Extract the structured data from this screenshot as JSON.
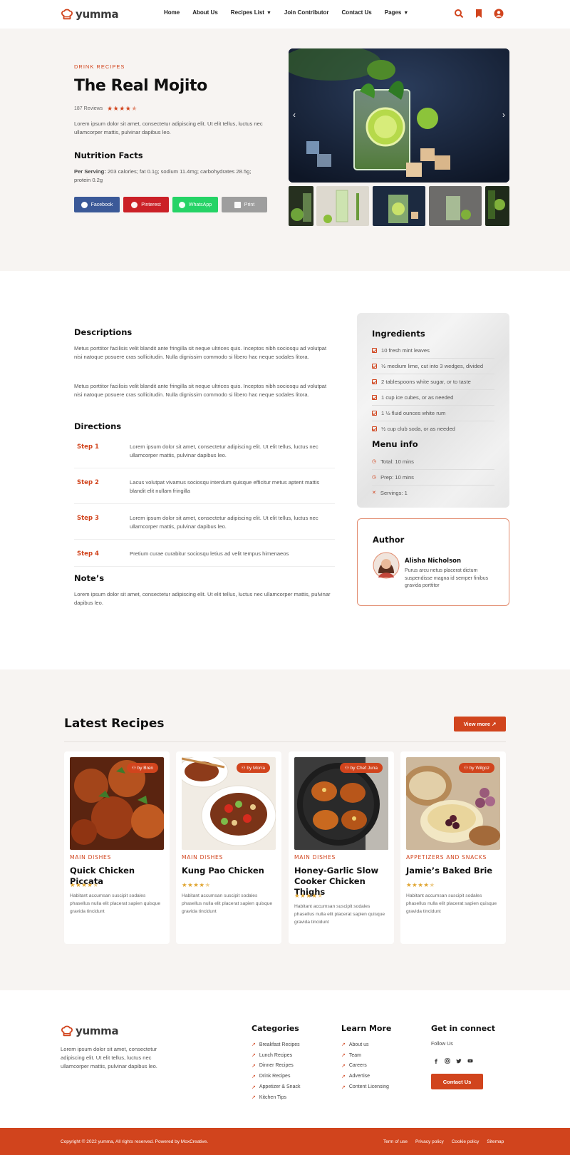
{
  "header": {
    "brand": "yumma",
    "nav": [
      "Home",
      "About Us",
      "Recipes List",
      "Join Contributor",
      "Contact Us",
      "Pages"
    ],
    "colors": {
      "accent": "#d1441d"
    }
  },
  "hero": {
    "kicker": "DRINK RECIPES",
    "title": "The Real Mojito",
    "reviews": "187 Reviews",
    "rating": 4.5,
    "intro": "Lorem ipsum dolor sit amet, consectetur adipiscing elit. Ut elit tellus, luctus nec ullamcorper mattis, pulvinar dapibus leo.",
    "nutrition_title": "Nutrition Facts",
    "per_serving_label": "Per Serving:",
    "per_serving_value": " 203 calories; fat 0.1g; sodium 11.4mg; carbohydrates 28.5g; protein 0.2g",
    "share": [
      {
        "label": "Facebook",
        "color": "#3b5998"
      },
      {
        "label": "Pinterest",
        "color": "#cb2027"
      },
      {
        "label": "WhatsApp",
        "color": "#25d366"
      },
      {
        "label": "Print",
        "color": "#9e9e9e"
      }
    ]
  },
  "content": {
    "desc_title": "Descriptions",
    "desc1": "Metus porttitor facilisis velit blandit ante fringilla sit neque ultrices quis. Inceptos nibh sociosqu ad volutpat nisi natoque posuere cras sollicitudin. Nulla dignissim commodo si libero hac neque sodales litora.",
    "desc2": "Metus porttitor facilisis velit blandit ante fringilla sit neque ultrices quis. Inceptos nibh sociosqu ad volutpat nisi natoque posuere cras sollicitudin. Nulla dignissim commodo si libero hac neque sodales litora.",
    "directions_title": "Directions",
    "steps": [
      {
        "label": "Step 1",
        "text": "Lorem ipsum dolor sit amet, consectetur adipiscing elit. Ut elit tellus, luctus nec ullamcorper mattis, pulvinar dapibus leo."
      },
      {
        "label": "Step 2",
        "text": "Lacus volutpat vivamus sociosqu interdum quisque efficitur metus aptent mattis blandit elit nullam fringilla"
      },
      {
        "label": "Step 3",
        "text": "Lorem ipsum dolor sit amet, consectetur adipiscing elit. Ut elit tellus, luctus nec ullamcorper mattis, pulvinar dapibus leo."
      },
      {
        "label": "Step 4",
        "text": "Pretium curae curabitur sociosqu letius ad velit tempus himenaeos"
      }
    ],
    "notes_title": "Note’s",
    "notes": "Lorem ipsum dolor sit amet, consectetur adipiscing elit. Ut elit tellus, luctus nec ullamcorper mattis, pulvinar dapibus leo."
  },
  "ingredients": {
    "title": "Ingredients",
    "items": [
      "10 fresh mint leaves",
      "½ medium lime, cut into 3 wedges, divided",
      "2 tablespoons white sugar, or to taste",
      "1 cup ice cubes, or as needed",
      "1 ½ fluid ounces white rum",
      "½ cup club soda, or as needed"
    ],
    "menu_title": "Menu info",
    "menu": [
      "Total: 10 mins",
      "Prep: 10 mins",
      "Servings: 1"
    ]
  },
  "author": {
    "title": "Author",
    "name": "Alisha Nicholson",
    "bio": "Purus arcu netus placerat dictum suspendisse magna id semper finibus gravida porttitor"
  },
  "latest": {
    "title": "Latest Recipes",
    "view_more": "View more ↗",
    "cards": [
      {
        "by": "by Bren",
        "category": "MAIN DISHES",
        "title": "Quick Chicken Piccata",
        "rating": 4.5,
        "desc": "Habitant accumsan suscipit sodales phasellus nulla elit placerat sapien quisque gravida tincidunt"
      },
      {
        "by": "by Morra",
        "category": "MAIN DISHES",
        "title": "Kung Pao Chicken",
        "rating": 4.5,
        "desc": "Habitant accumsan suscipit sodales phasellus nulla elit placerat sapien quisque gravida tincidunt"
      },
      {
        "by": "by Chef Juna",
        "category": "MAIN DISHES",
        "title": "Honey-Garlic Slow Cooker Chicken Thighs",
        "rating": 4.5,
        "desc": "Habitant accumsan suscipit sodales phasellus nulla elit placerat sapien quisque gravida tincidunt"
      },
      {
        "by": "by Wilgoz",
        "category": "APPETIZERS AND SNACKS",
        "title": "Jamie’s Baked Brie",
        "rating": 4.5,
        "desc": "Habitant accumsan suscipit sodales phasellus nulla elit placerat sapien quisque gravida tincidunt"
      }
    ]
  },
  "footer": {
    "brand": "yumma",
    "about": "Lorem ipsum dolor sit amet, consectetur adipiscing elit. Ut elit tellus, luctus nec ullamcorper mattis, pulvinar dapibus leo.",
    "categories_title": "Categories",
    "categories": [
      "Breakfast Recipes",
      "Lunch Recipes",
      "Dinner Recipes",
      "Drink Recipes",
      "Appetizer & Snack",
      "Kitchen Tips"
    ],
    "learn_title": "Learn More",
    "learn": [
      "About us",
      "Team",
      "Careers",
      "Advertise",
      "Content Licensing"
    ],
    "connect_title": "Get in connect",
    "follow": "Follow Us",
    "socials": [
      "facebook-icon",
      "instagram-icon",
      "twitter-icon",
      "youtube-icon"
    ],
    "contact_button": "Contact Us",
    "copyright": "Copyright © 2022 yumma, All rights reserved. Powered by MoxCreative.",
    "bottom_links": [
      "Term of use",
      "Privacy policy",
      "Cookie policy",
      "Sitemap"
    ]
  }
}
